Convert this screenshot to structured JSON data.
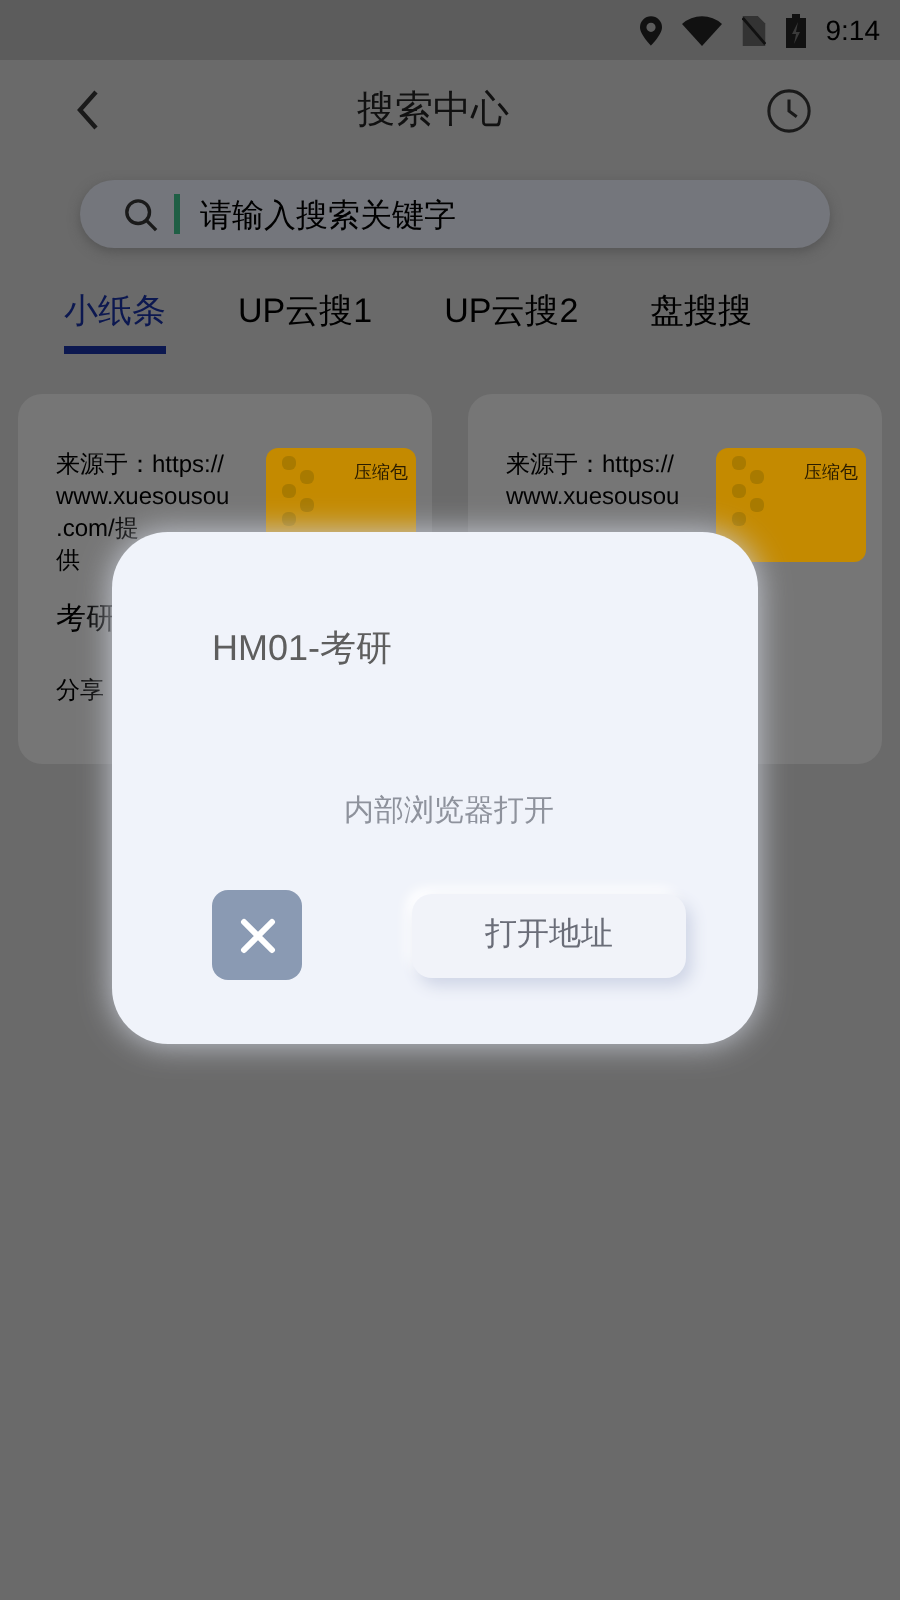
{
  "status_bar": {
    "time": "9:14"
  },
  "header": {
    "title": "搜索中心"
  },
  "search": {
    "placeholder": "请输入搜索关键字"
  },
  "tabs": [
    {
      "label": "小纸条",
      "selected": true
    },
    {
      "label": "UP云搜1",
      "selected": false
    },
    {
      "label": "UP云搜2",
      "selected": false
    },
    {
      "label": "盘搜搜",
      "selected": false
    }
  ],
  "cards": [
    {
      "source_lines": [
        "来源于：https://",
        "www.xuesousou",
        ".com/提",
        "供"
      ],
      "badge": "压缩包",
      "title": "考研",
      "meta": "分享"
    },
    {
      "source_lines": [
        "来源于：https://",
        "www.xuesousou"
      ],
      "badge": "压缩包"
    }
  ],
  "dialog": {
    "title": "HM01-考研",
    "message": "内部浏览器打开",
    "confirm": "打开地址"
  }
}
